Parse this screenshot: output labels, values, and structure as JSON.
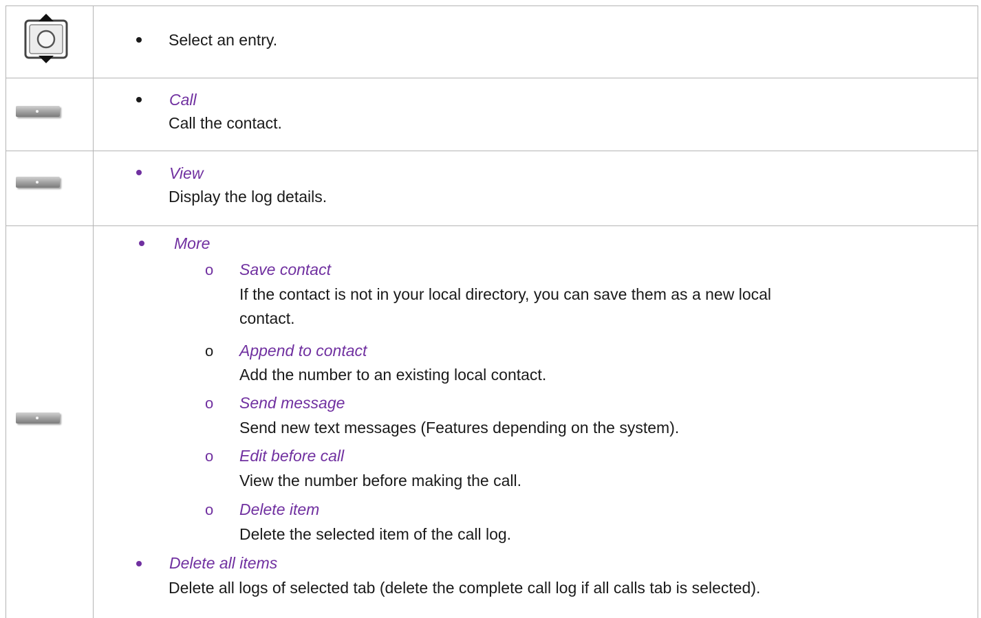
{
  "rows": [
    {
      "icon": "navigation-key-icon",
      "items": [
        {
          "text": "Select an entry."
        }
      ]
    },
    {
      "icon": "softkey-icon",
      "items": [
        {
          "label": "Call",
          "description": "Call the contact."
        }
      ]
    },
    {
      "icon": "softkey-icon",
      "items": [
        {
          "label": "View",
          "description": "Display the log details."
        }
      ]
    },
    {
      "icon": "softkey-icon",
      "items": [
        {
          "label": "More",
          "subitems": [
            {
              "label": "Save contact",
              "description_lines": [
                "If the contact is not in your local directory, you can save them as a new local",
                "contact."
              ]
            },
            {
              "label": "Append to contact",
              "description": "Add the number to an existing local contact."
            },
            {
              "label": "Send message",
              "description": "Send new text messages (Features depending on the system)."
            },
            {
              "label": "Edit before call",
              "description": "View the number before making the call."
            },
            {
              "label": "Delete item",
              "description": "Delete the selected item of the call log."
            }
          ]
        },
        {
          "label": "Delete all items",
          "description": "Delete all logs of selected tab (delete the complete call log if all calls tab is selected)."
        }
      ]
    }
  ],
  "colors": {
    "label": "#7030a0",
    "text": "#1a1a1a",
    "border": "#b4b4b4"
  }
}
